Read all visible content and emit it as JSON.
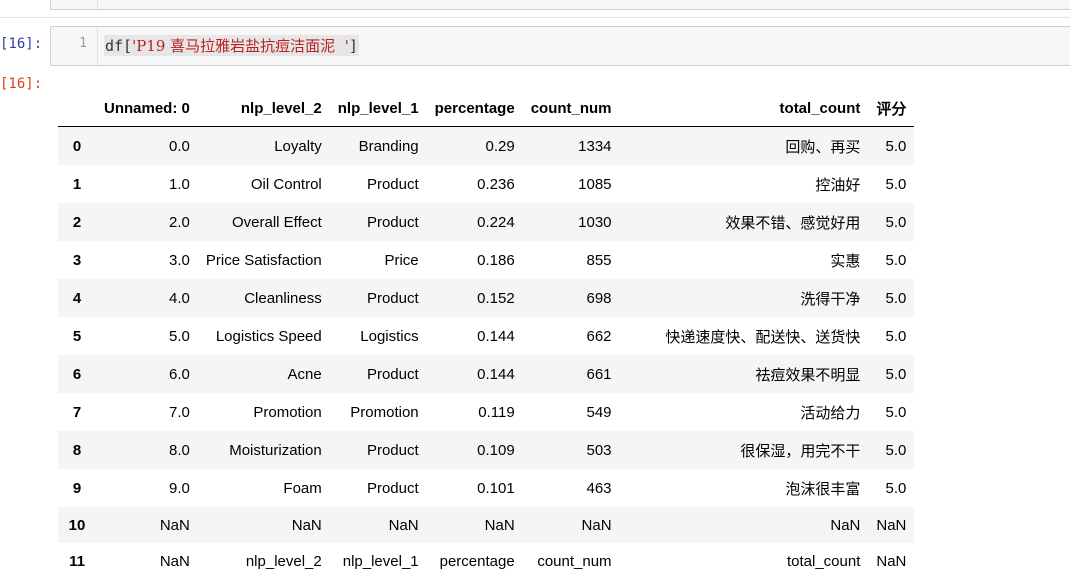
{
  "cells": {
    "input_prompt": "[16]:",
    "output_prompt": "[16]:",
    "line_number": "1",
    "code_prefix": "df[",
    "code_string": "'P19 喜马拉雅岩盐抗痘洁面泥  '",
    "code_suffix": "]"
  },
  "table": {
    "columns": [
      "",
      "Unnamed: 0",
      "nlp_level_2",
      "nlp_level_1",
      "percentage",
      "count_num",
      "total_count",
      "评分"
    ],
    "rows": [
      [
        "0",
        "0.0",
        "Loyalty",
        "Branding",
        "0.29",
        "1334",
        "回购、再买",
        "5.0"
      ],
      [
        "1",
        "1.0",
        "Oil Control",
        "Product",
        "0.236",
        "1085",
        "控油好",
        "5.0"
      ],
      [
        "2",
        "2.0",
        "Overall Effect",
        "Product",
        "0.224",
        "1030",
        "效果不错、感觉好用",
        "5.0"
      ],
      [
        "3",
        "3.0",
        "Price Satisfaction",
        "Price",
        "0.186",
        "855",
        "实惠",
        "5.0"
      ],
      [
        "4",
        "4.0",
        "Cleanliness",
        "Product",
        "0.152",
        "698",
        "洗得干净",
        "5.0"
      ],
      [
        "5",
        "5.0",
        "Logistics Speed",
        "Logistics",
        "0.144",
        "662",
        "快递速度快、配送快、送货快",
        "5.0"
      ],
      [
        "6",
        "6.0",
        "Acne",
        "Product",
        "0.144",
        "661",
        "祛痘效果不明显",
        "5.0"
      ],
      [
        "7",
        "7.0",
        "Promotion",
        "Promotion",
        "0.119",
        "549",
        "活动给力",
        "5.0"
      ],
      [
        "8",
        "8.0",
        "Moisturization",
        "Product",
        "0.109",
        "503",
        "很保湿，用完不干",
        "5.0"
      ],
      [
        "9",
        "9.0",
        "Foam",
        "Product",
        "0.101",
        "463",
        "泡沫很丰富",
        "5.0"
      ],
      [
        "10",
        "NaN",
        "NaN",
        "NaN",
        "NaN",
        "NaN",
        "NaN",
        "NaN"
      ],
      [
        "11",
        "NaN",
        "nlp_level_2",
        "nlp_level_1",
        "percentage",
        "count_num",
        "total_count",
        "NaN"
      ]
    ]
  }
}
